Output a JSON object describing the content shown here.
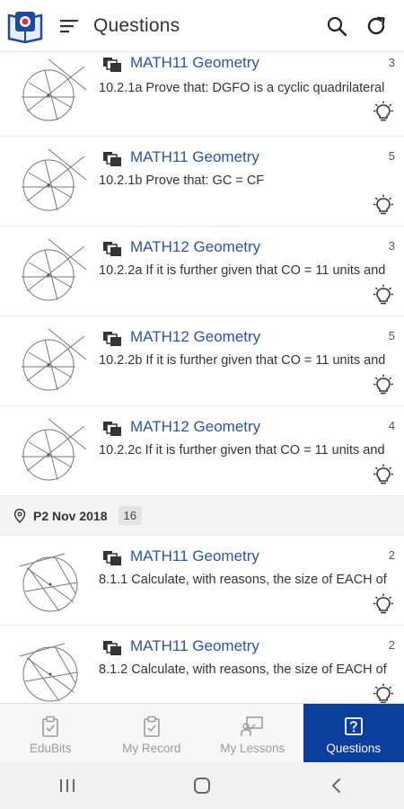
{
  "header": {
    "title": "Questions"
  },
  "list": {
    "items_top": [
      {
        "subject": "MATH11 Geometry",
        "count": "3",
        "text": "10.2.1a Prove that: DGFO is a cyclic quadrilateral"
      },
      {
        "subject": "MATH11 Geometry",
        "count": "5",
        "text": "10.2.1b Prove that: GC = CF"
      },
      {
        "subject": "MATH12 Geometry",
        "count": "3",
        "text": "10.2.2a If it is further given that CO = 11 units and"
      },
      {
        "subject": "MATH12 Geometry",
        "count": "5",
        "text": "10.2.2b If it is further given that CO = 11 units and"
      },
      {
        "subject": "MATH12 Geometry",
        "count": "4",
        "text": "10.2.2c If it is further given that CO = 11 units and"
      }
    ],
    "section": {
      "title": "P2 Nov 2018",
      "badge": "16"
    },
    "items_bottom": [
      {
        "subject": "MATH11 Geometry",
        "count": "2",
        "text": "8.1.1 Calculate, with reasons, the size of EACH of"
      },
      {
        "subject": "MATH11 Geometry",
        "count": "2",
        "text": "8.1.2 Calculate, with reasons, the size of EACH of"
      }
    ]
  },
  "bottom_nav": [
    {
      "label": "EduBits",
      "icon": "clipboard-icon",
      "active": false
    },
    {
      "label": "My Record",
      "icon": "clipboard-check-icon",
      "active": false
    },
    {
      "label": "My Lessons",
      "icon": "teacher-board-icon",
      "active": false
    },
    {
      "label": "Questions",
      "icon": "question-box-icon",
      "active": true
    }
  ],
  "colors": {
    "accent": "#0a3e9c",
    "subject_link": "#2a52a8"
  }
}
